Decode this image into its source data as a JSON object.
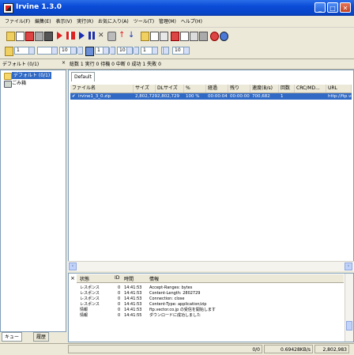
{
  "window": {
    "title": "Irvine 1.3.0"
  },
  "menu": [
    "ファイル(F)",
    "編集(E)",
    "表示(V)",
    "実行(R)",
    "お気に入り(A)",
    "ツール(T)",
    "管理(M)",
    "ヘルプ(H)"
  ],
  "options": {
    "threads": "1",
    "timeout": "10",
    "retry": "1",
    "retry_wait": "10",
    "max_jobs": "1",
    "interval": "10"
  },
  "status_top": {
    "queue_label": "デフォルト (0/1)",
    "close": "×",
    "summary": "総数 1 実行 0 待機 0 中断 0 成功 1 失敗 0"
  },
  "tree": {
    "items": [
      "デフォルト (0/1)",
      "ごみ箱"
    ]
  },
  "left_tabs": [
    "キュー",
    "履歴"
  ],
  "file_list": {
    "tab": "Default",
    "columns": [
      "ファイル名",
      "サイズ",
      "DLサイズ",
      "%",
      "経過",
      "残り",
      "速度(B/s)",
      "回数",
      "CRC/MD...",
      "URL"
    ],
    "rows": [
      {
        "name": "irvine1_3_0.zip",
        "size": "2,802,729",
        "dl_size": "2,802,729",
        "pct": "100 %",
        "elapsed": "00:00:04",
        "remaining": "00:00:00",
        "speed": "700,682",
        "count": "1",
        "crc": "",
        "url": "http://ftp.ve"
      }
    ]
  },
  "log": {
    "close": "×",
    "columns": [
      "状態",
      "ID",
      "時間",
      "情報"
    ],
    "rows": [
      {
        "status": "レスポンス",
        "id": "0",
        "time": "14:41:53",
        "info": "Accept-Ranges: bytes"
      },
      {
        "status": "レスポンス",
        "id": "0",
        "time": "14:41:53",
        "info": "Content-Length: 2802729"
      },
      {
        "status": "レスポンス",
        "id": "0",
        "time": "14:41:53",
        "info": "Connection: close"
      },
      {
        "status": "レスポンス",
        "id": "0",
        "time": "14:41:53",
        "info": "Content-Type: application/zip"
      },
      {
        "status": "情報",
        "id": "0",
        "time": "14:41:53",
        "info": "ftp.vector.co.jp の受信を開始します"
      },
      {
        "status": "情報",
        "id": "0",
        "time": "14:41:55",
        "info": "ダウンロードに成功しました"
      }
    ]
  },
  "statusbar": {
    "jobs": "0/0",
    "speed": "0.69428KB/s",
    "total": "2,802,983"
  }
}
